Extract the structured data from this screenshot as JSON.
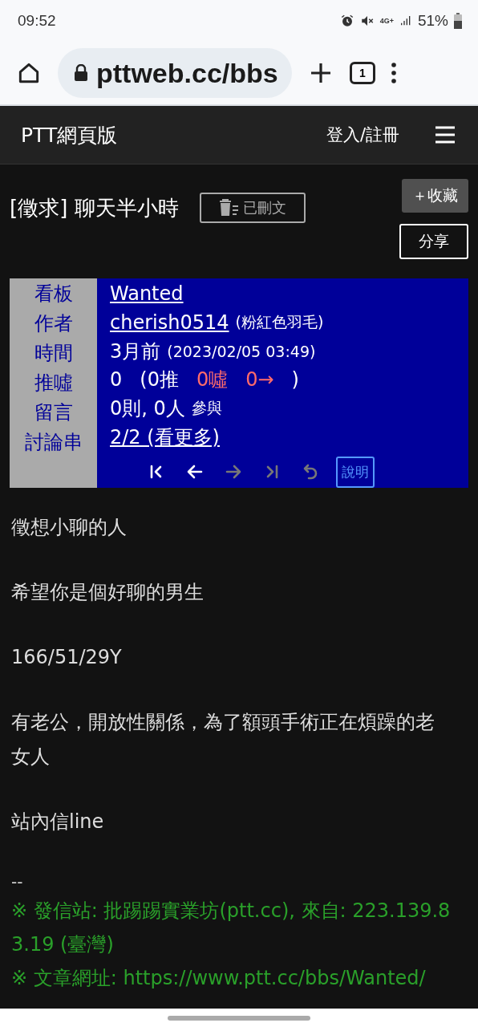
{
  "status_bar": {
    "time": "09:52",
    "network": "4G+",
    "battery": "51%"
  },
  "browser": {
    "url": "pttweb.cc/bbs",
    "tab_count": "1"
  },
  "site_header": {
    "title": "PTT網頁版",
    "login": "登入/註冊"
  },
  "article": {
    "title": "[徵求] 聊天半小時",
    "deleted_badge": "已刪文",
    "favorite_button": "＋收藏",
    "share_button": "分享"
  },
  "meta": [
    {
      "label": "看板",
      "kind": "link",
      "parts": [
        {
          "text": "Wanted"
        }
      ]
    },
    {
      "label": "作者",
      "kind": "link_note",
      "parts": [
        {
          "text": "cherish0514"
        },
        {
          "text": "(粉紅色羽毛)"
        }
      ]
    },
    {
      "label": "時間",
      "kind": "text_note",
      "parts": [
        {
          "text": "3月前"
        },
        {
          "text": "(2023/02/05 03:49)"
        }
      ]
    },
    {
      "label": "推噓",
      "kind": "counts",
      "parts": [
        {
          "text": "0",
          "color": "#ffffff"
        },
        {
          "text": "(0推",
          "color": "#ffffff"
        },
        {
          "text": "0噓",
          "color": "#ff6b6b"
        },
        {
          "text": "0→",
          "color": "#ff6b6b"
        },
        {
          "text": ")",
          "color": "#ffffff"
        }
      ]
    },
    {
      "label": "留言",
      "kind": "text_note",
      "parts": [
        {
          "text": "0則, 0人"
        },
        {
          "text": "參與"
        }
      ]
    },
    {
      "label": "討論串",
      "kind": "link",
      "parts": [
        {
          "text": "2/2 (看更多)"
        }
      ]
    }
  ],
  "nav": [
    {
      "kind": "first",
      "disabled": false
    },
    {
      "kind": "prev",
      "disabled": false
    },
    {
      "kind": "next",
      "disabled": true
    },
    {
      "kind": "last",
      "disabled": true
    },
    {
      "kind": "back",
      "disabled": true
    }
  ],
  "help_button": "說明",
  "body": [
    "徵想小聊的人",
    "希望你是個好聊的男生",
    "166/51/29Y",
    "有老公，開放性關係，為了額頭手術正在煩躁的老女人",
    "站內信line"
  ],
  "separator": "--",
  "signature": [
    "※ 發信站: 批踢踢實業坊(ptt.cc), 來自: 223.139.83.19 (臺灣)",
    "※ 文章網址: https://www.ptt.cc/bbs/Wanted/"
  ]
}
